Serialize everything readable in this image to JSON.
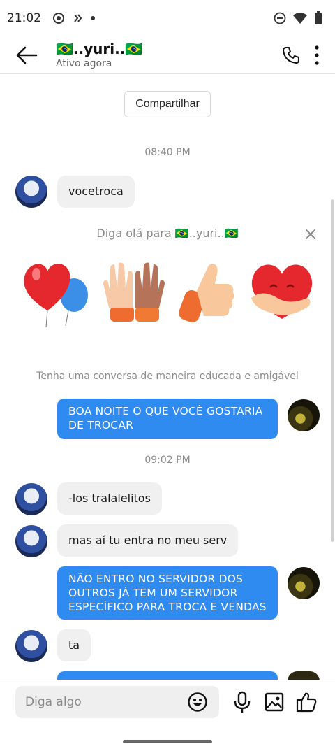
{
  "status_bar": {
    "time": "21:02"
  },
  "header": {
    "name": "🇧🇷..yuri..🇧🇷",
    "status": "Ativo agora"
  },
  "share_label": "Compartilhar",
  "timestamps": [
    "08:40 PM",
    "09:02 PM"
  ],
  "messages": [
    {
      "direction": "in",
      "text": "vocetroca"
    },
    {
      "direction": "out",
      "text": "BOA NOITE O QUE VOCÊ GOSTARIA DE TROCAR"
    },
    {
      "direction": "in",
      "text": "-los tralalelitos"
    },
    {
      "direction": "in",
      "text": "mas aí tu entra no meu serv"
    },
    {
      "direction": "out",
      "text": "NÃO ENTRO NO SERVIDOR DOS OUTROS JÁ TEM UM SERVIDOR ESPECÍFICO PARA TROCA E VENDAS"
    },
    {
      "direction": "in",
      "text": "ta"
    }
  ],
  "greeting": {
    "title": "Diga olá para 🇧🇷..yuri..🇧🇷",
    "stickers": [
      "heart-balloons-sticker",
      "high-five-sticker",
      "thumbs-up-sticker",
      "hugging-heart-sticker"
    ]
  },
  "etiquette": "Tenha uma conversa de maneira educada e amigável",
  "composer": {
    "placeholder": "Diga algo"
  },
  "colors": {
    "accent": "#2f8bf0",
    "incoming_bubble": "#f0f0f0"
  }
}
